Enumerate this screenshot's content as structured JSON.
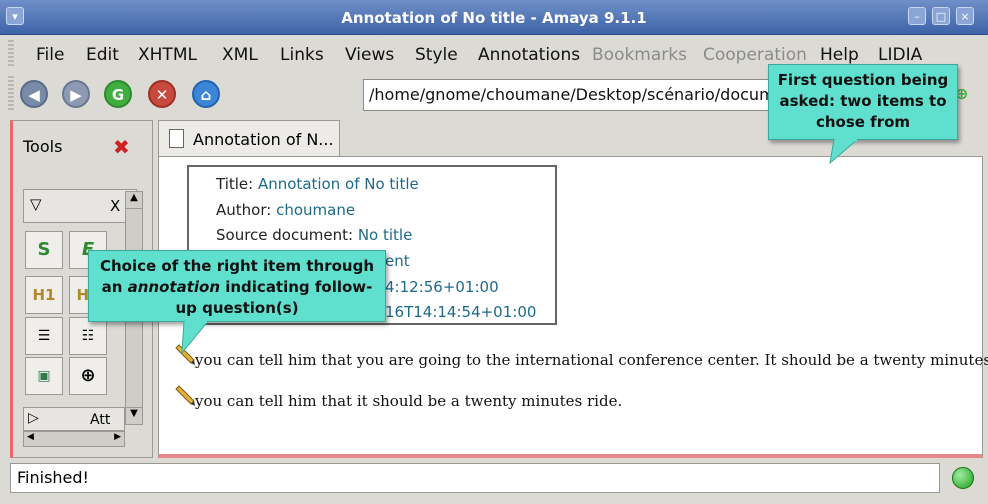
{
  "window": {
    "title": "Annotation of No title - Amaya 9.1.1"
  },
  "menu": [
    "File",
    "Edit",
    "XHTML",
    "XML",
    "Links",
    "Views",
    "Style",
    "Annotations",
    "Bookmarks",
    "Cooperation",
    "Help",
    "LIDIA"
  ],
  "toolbar": {
    "address": "/home/gnome/choumane/Desktop/scénario/docume"
  },
  "tools_panel": {
    "title": "Tools",
    "section1_label": "X",
    "section2_label": "Att"
  },
  "tab": {
    "label": "Annotation of N..."
  },
  "annotation_meta": {
    "title_key": "Title:",
    "title_val": "Annotation of No title",
    "author_key": "Author:",
    "author_val": "choumane",
    "source_key": "Source document:",
    "source_val": "No title",
    "type_val": "ent",
    "created_val": "4:12:56+01:00",
    "modified_val": "16T14:14:54+01:00"
  },
  "doc_lines": [
    "you can tell him that you are going to the international conference center. It should be a twenty minutes ride.",
    "you can tell him that it should be a twenty minutes ride."
  ],
  "callout_top": {
    "text": "First question being asked: two items to chose from"
  },
  "callout_left": {
    "line1": "Choice of the right item through",
    "line2a": "an ",
    "line2b": "annotation",
    "line2c": " indicating follow-",
    "line3": "up question(s)"
  },
  "status": {
    "text": "Finished!"
  },
  "colors": {
    "accent": "#3e63a8",
    "callout": "#5fe0cf",
    "link": "#1b6a8c"
  }
}
